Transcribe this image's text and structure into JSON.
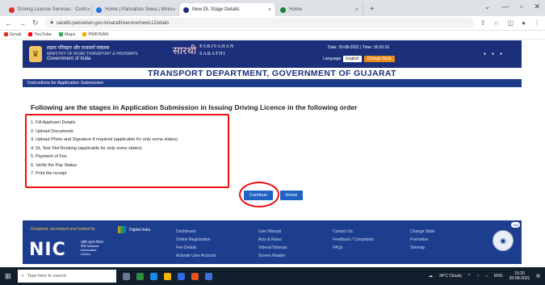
{
  "browser": {
    "tabs": [
      {
        "label": "Driving License Services · Contr",
        "favicon_color": "#d93025"
      },
      {
        "label": "Home | Parivahan Sewa | Minis",
        "favicon_color": "#1a73e8"
      },
      {
        "label": "New DL Stage Details",
        "favicon_color": "#1b2f7a",
        "active": true
      },
      {
        "label": "Home",
        "favicon_color": "#188038"
      }
    ],
    "new_tab": "+",
    "url": "sarathi.parivahan.gov.in/sarathiservice/newLLDetails",
    "bookmarks": [
      {
        "label": "Gmail",
        "color": "#d93025"
      },
      {
        "label": "YouTube",
        "color": "#ff0000"
      },
      {
        "label": "Maps",
        "color": "#34a853"
      },
      {
        "label": "PMKISAN",
        "color": "#f9ab00"
      }
    ]
  },
  "site": {
    "ministry_hi": "सड़क परिवहन और राजमार्ग मंत्रालय",
    "ministry_en": "MINISTRY OF ROAD TRANSPORT & HIGHWAYS",
    "gov": "Government of India",
    "brand_hi": "सारथी",
    "brand_en1": "PARIVAHAN",
    "brand_en2": "SARATHI",
    "dates": "Date: 20-08-2021 | Time: 16:20:16",
    "language_label": "Language",
    "language_value": "English",
    "change_button": "Change Style",
    "dept_title": "TRANSPORT DEPARTMENT, GOVERNMENT OF GUJARAT",
    "instructions_bar": "Instructions for Application Submission"
  },
  "main": {
    "heading": "Following are the stages in Application Submission in Issuing Driving Licence in the following order",
    "steps": [
      "1. Fill Applicant Details",
      "2. Upload Documents",
      "3. Upload Photo and Signature if required (applicable for only some states)",
      "4. DL Test Slot Booking (applicable for only some states)",
      "5. Payment of Fee",
      "6. Verify the Pay Status",
      "7. Print the receipt"
    ],
    "continue_label": "Continue",
    "home_label": "Home"
  },
  "footer": {
    "top_text": "Designed, developed and hosted by",
    "nic": "NIC",
    "nic_sub": "राष्ट्रीय सूचना विज्ञान केन्द्र National Informatics Centre",
    "digital_india": "Digital India",
    "col1": [
      "Dashboard",
      "Online Registration",
      "Fee Details",
      "Activate User Account"
    ],
    "col2": [
      "User Manual",
      "Acts & Rules",
      "Videos/Tutorials",
      "Screen Reader"
    ],
    "col3": [
      "Contact Us",
      "Feedback / Complaints",
      "FAQs"
    ],
    "col4": [
      "Change State",
      "Formation",
      "Sitemap"
    ],
    "robot_tag": "Ask"
  },
  "taskbar": {
    "search_placeholder": "Type here to search",
    "weather": "34°C Cloudy",
    "lang": "ENG",
    "time": "15:20",
    "date": "20-08-2021"
  }
}
